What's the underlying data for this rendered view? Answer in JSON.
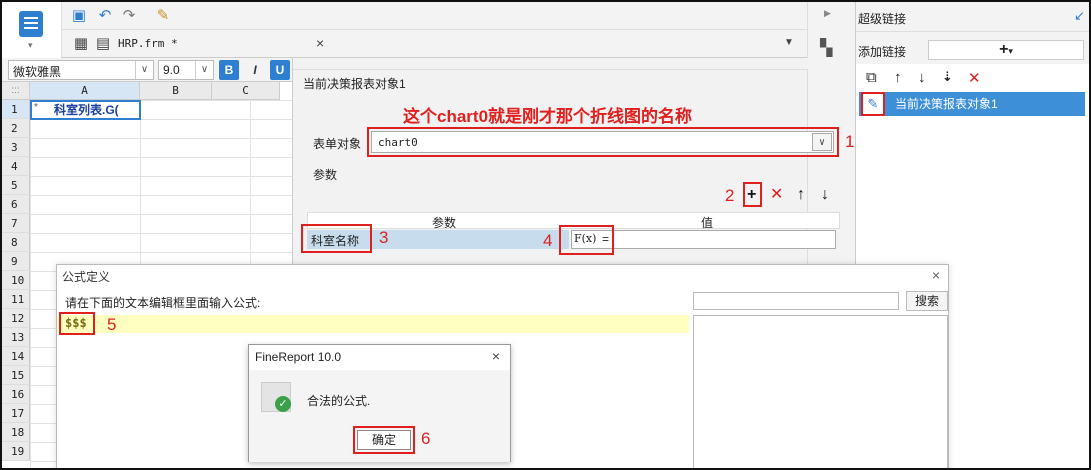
{
  "tab": {
    "title": "HRP.frm *",
    "close": "×"
  },
  "font_bar": {
    "font": "微软雅黑",
    "size": "9.0",
    "bold": "B",
    "italic": "I",
    "underline": "U"
  },
  "sheet": {
    "corner": ":::",
    "columns": [
      "A",
      "B",
      "C"
    ],
    "rows": [
      "1",
      "2",
      "3",
      "4",
      "5",
      "6",
      "7",
      "8",
      "9",
      "10",
      "11",
      "12",
      "13",
      "14",
      "15",
      "16",
      "17",
      "18",
      "19"
    ],
    "cell_a1": "科室列表.G(",
    "cell_a1_mark": "*"
  },
  "panel": {
    "title": "当前决策报表对象1",
    "annotation": "这个chart0就是刚才那个折线图的名称",
    "form_object_label": "表单对象",
    "form_object_value": "chart0",
    "params_label": "参数",
    "col_param": "参数",
    "col_value": "值",
    "param_name": "科室名称",
    "fx": "F(x)",
    "equals": "="
  },
  "hyperlink": {
    "title": "超级链接",
    "add_label": "添加链接",
    "add_button": "+",
    "item": "当前决策报表对象1"
  },
  "formula": {
    "title": "公式定义",
    "hint": "请在下面的文本编辑框里面输入公式:",
    "content": "$$$",
    "search_button": "搜索",
    "close": "×"
  },
  "confirm": {
    "title": "FineReport 10.0",
    "message": "合法的公式.",
    "ok": "确定",
    "close": "×"
  },
  "steps": [
    "1",
    "2",
    "3",
    "4",
    "5",
    "6"
  ],
  "colors": {
    "accent": "#2e7fd0",
    "annotation": "#e0201e",
    "selection": "#3d8fd8"
  }
}
